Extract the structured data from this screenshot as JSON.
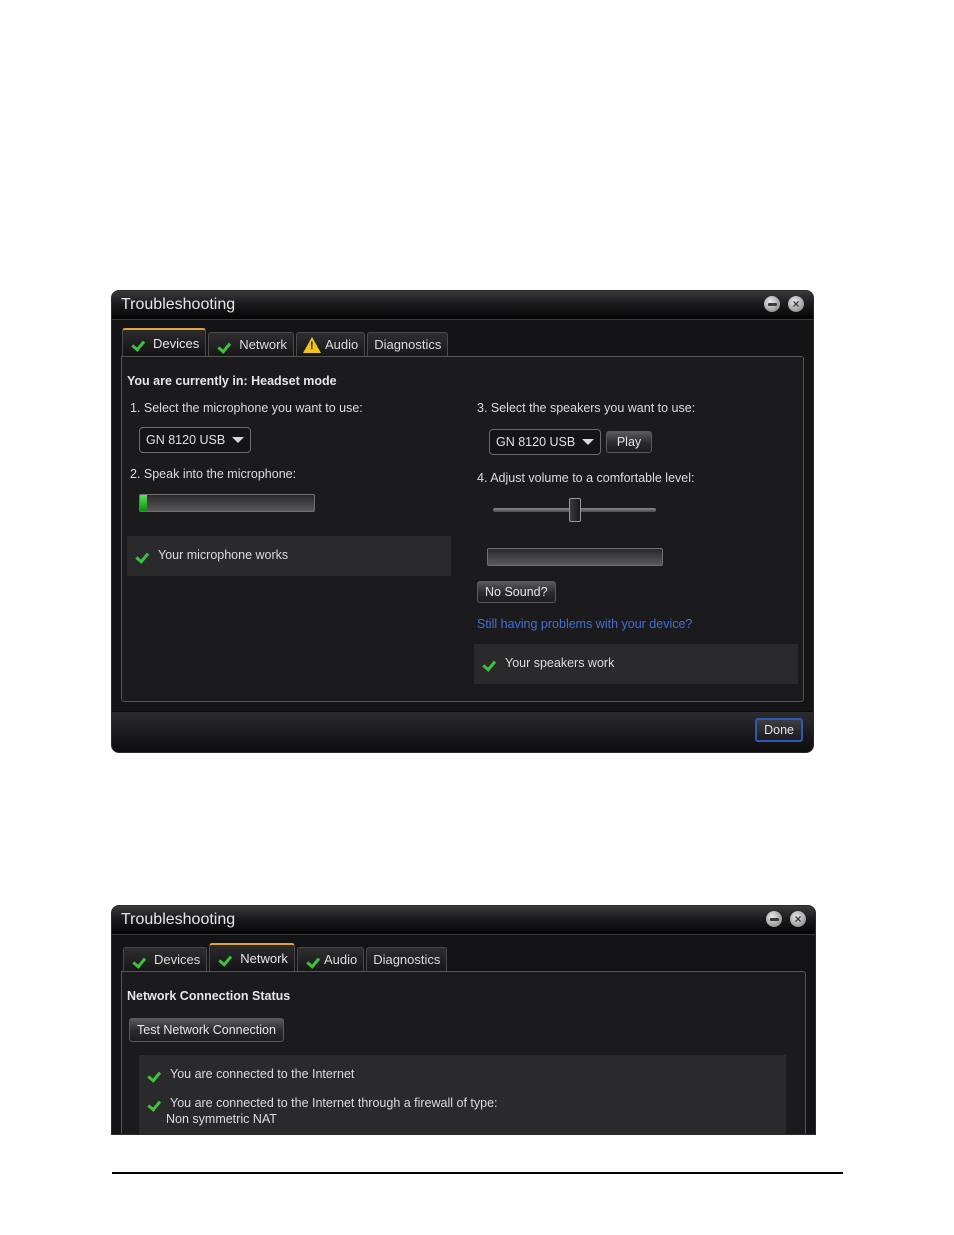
{
  "dialogs": [
    {
      "title": "Troubleshooting",
      "tabs": [
        {
          "label": "Devices",
          "status": "ok",
          "active": true
        },
        {
          "label": "Network",
          "status": "ok",
          "active": false
        },
        {
          "label": "Audio",
          "status": "warning",
          "active": false
        },
        {
          "label": "Diagnostics",
          "status": "none",
          "active": false
        }
      ],
      "devices": {
        "mode_text": "You are currently in: Headset mode",
        "step1_label": "1. Select the microphone you want to use:",
        "microphone_selected": "GN 8120 USB",
        "step2_label": "2. Speak into the microphone:",
        "mic_level_percent": 4,
        "mic_status": "Your microphone works",
        "step3_label": "3. Select the speakers you want to use:",
        "speakers_selected": "GN 8120 USB",
        "play_label": "Play",
        "step4_label": "4. Adjust volume to a comfortable level:",
        "volume_percent": 50,
        "speaker_level_percent": 0,
        "no_sound_label": "No Sound?",
        "help_link": "Still having problems with your device?",
        "speaker_status": "Your speakers work"
      },
      "done_label": "Done"
    },
    {
      "title": "Troubleshooting",
      "tabs": [
        {
          "label": "Devices",
          "status": "ok",
          "active": false
        },
        {
          "label": "Network",
          "status": "ok",
          "active": true
        },
        {
          "label": "Audio",
          "status": "ok",
          "active": false
        },
        {
          "label": "Diagnostics",
          "status": "none",
          "active": false
        }
      ],
      "network": {
        "heading": "Network Connection Status",
        "test_button": "Test Network Connection",
        "results": [
          {
            "text": "You are connected to the Internet"
          },
          {
            "text": "You are connected to the Internet through a firewall of type:",
            "detail": "Non symmetric  NAT"
          }
        ]
      }
    }
  ],
  "colors": {
    "accent_tab": "#e0a23a",
    "ok_check": "#3ec23e",
    "warning": "#f0c419",
    "link": "#3f6fd6",
    "primary_button_border": "#2f57b8"
  }
}
